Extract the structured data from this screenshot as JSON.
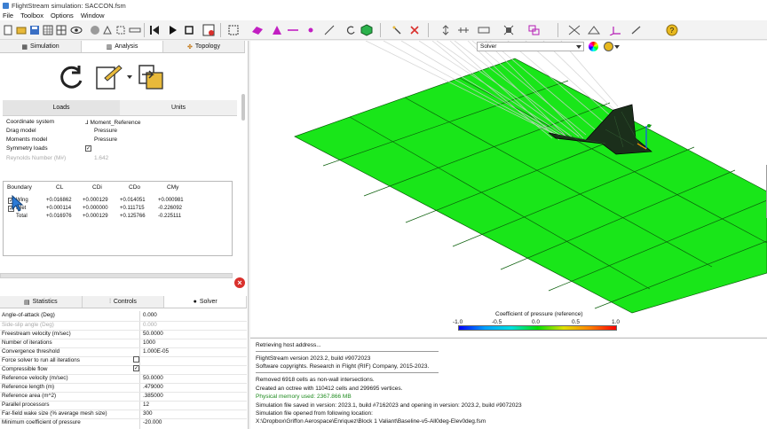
{
  "window": {
    "title": "FlightStream simulation: SACCON.fsm"
  },
  "menu": [
    "File",
    "Toolbox",
    "Options",
    "Window"
  ],
  "left_tabs": [
    {
      "label": "Simulation",
      "icon": "grid-icon"
    },
    {
      "label": "Analysis",
      "icon": "bar-chart-icon"
    },
    {
      "label": "Topology",
      "icon": "puzzle-icon"
    }
  ],
  "loads": {
    "tab_loads": "Loads",
    "tab_units": "Units",
    "properties": [
      {
        "label": "Coordinate system",
        "value": "Moment_Reference"
      },
      {
        "label": "Drag model",
        "value": "Pressure"
      },
      {
        "label": "Moments model",
        "value": "Pressure"
      },
      {
        "label": "Symmetry loads",
        "value": ""
      },
      {
        "label": "Reynolds Number (M#)",
        "value": "1.642"
      }
    ]
  },
  "boundary_table": {
    "headers": [
      "Boundary",
      "CL",
      "CDi",
      "CDo",
      "CMy"
    ],
    "rows": [
      {
        "name": "Wing",
        "cl": "+0.016862",
        "cdi": "+0.000129",
        "cdo": "+0.014051",
        "cmy": "+0.000981"
      },
      {
        "name": "Inlet",
        "cl": "+0.000114",
        "cdi": "+0.000000",
        "cdo": "+0.111715",
        "cmy": "-0.226092"
      },
      {
        "name": "Total",
        "cl": "+0.016976",
        "cdi": "+0.000129",
        "cdo": "+0.125766",
        "cmy": "-0.225111"
      }
    ]
  },
  "bottom_tabs": [
    {
      "label": "Statistics",
      "icon": "stats-icon"
    },
    {
      "label": "Controls",
      "icon": "sliders-icon"
    },
    {
      "label": "Solver",
      "icon": "solver-icon"
    }
  ],
  "solver_settings": [
    {
      "label": "Angle-of-attack (Deg)",
      "value": "0.000"
    },
    {
      "label": "Side-slip angle (Deg)",
      "value": "0.000"
    },
    {
      "label": "Freestream velocity (m/sec)",
      "value": "50.0000"
    },
    {
      "label": "Number of iterations",
      "value": "1000"
    },
    {
      "label": "Convergence threshold",
      "value": "1.000E-05"
    },
    {
      "label": "Force solver to run all iterations",
      "value": ""
    },
    {
      "label": "Compressible flow",
      "value": ""
    },
    {
      "label": "Reference velocity (m/sec)",
      "value": "50.0000"
    },
    {
      "label": "Reference length (m)",
      "value": ".479000"
    },
    {
      "label": "Reference area (m^2)",
      "value": ".385000"
    },
    {
      "label": "Parallel processors",
      "value": "12"
    },
    {
      "label": "Far-field wake size (% average mesh size)",
      "value": "300"
    },
    {
      "label": "Minimum coefficient of pressure",
      "value": "-20.000"
    }
  ],
  "viewport": {
    "solver_dropdown": "Solver",
    "colorbar": {
      "title": "Coefficient of pressure (reference)",
      "ticks": [
        "-1.0",
        "-0.5",
        "0.0",
        "0.5",
        "1.0"
      ]
    }
  },
  "console": {
    "lines": [
      "Retrieving host address...",
      "FlightStream version 2023.2, build #9072023",
      "Software copyrights. Research in Flight (RIF) Company, 2015-2023.",
      "Removed 6918 cells as non-wall intersections.",
      "Created an octree with 110412 cells and 299695 vertices.",
      "Physical memory used: 2367.866 MB",
      "Simulation file saved in version: 2023.1, build #7162023 and opening in version: 2023.2, build #9072023",
      "Simulation file opened from following location:",
      "X:\\Dropbox\\Griffon Aerospace\\Enriquez\\Block 1 Valiant\\Baseline-v5-All0deg-Elev0deg.fsm"
    ]
  },
  "colors": {
    "surface": "#19e619",
    "accent": "#d9302c"
  }
}
